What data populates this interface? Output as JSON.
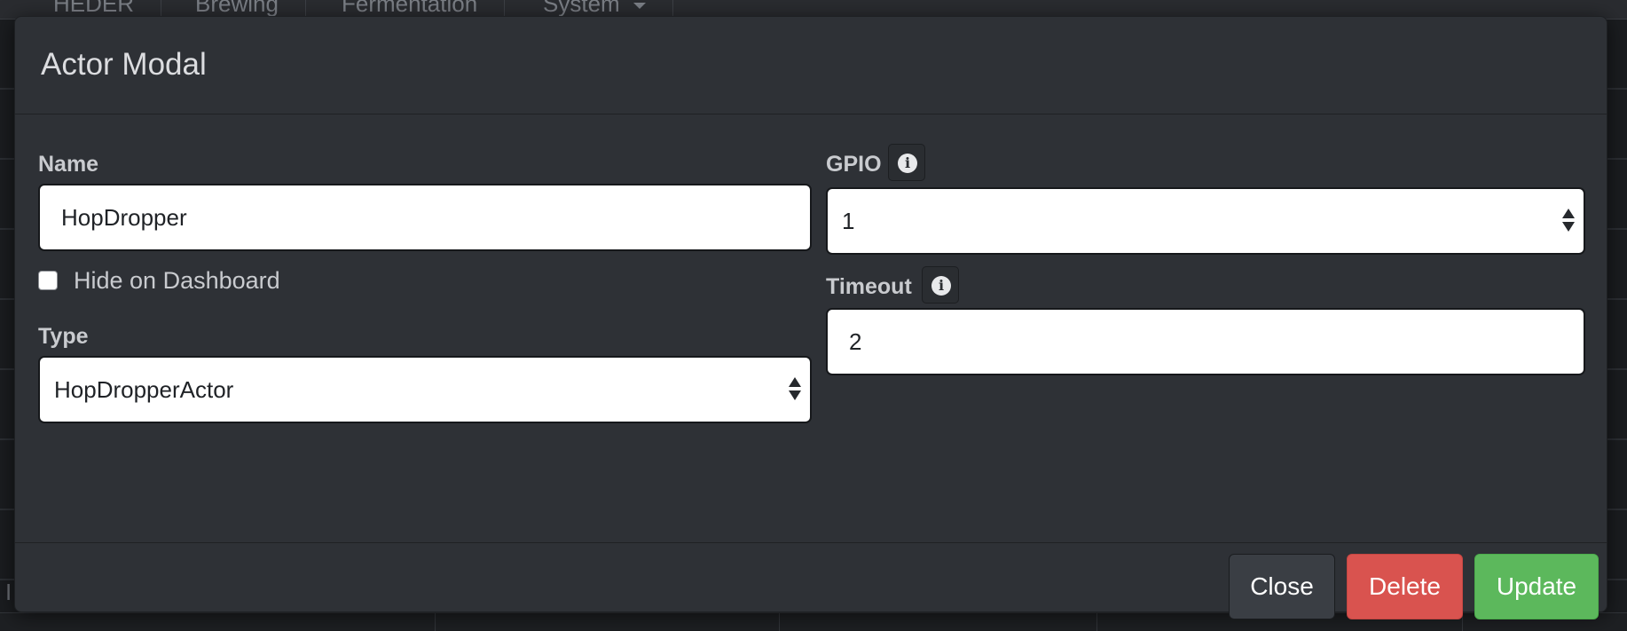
{
  "background": {
    "nav_items": [
      {
        "label": "HEDER"
      },
      {
        "label": "Brewing"
      },
      {
        "label": "Fermentation"
      },
      {
        "label": "System"
      }
    ],
    "edge_letter": "I"
  },
  "modal": {
    "title": "Actor Modal",
    "name": {
      "label": "Name",
      "value": "HopDropper"
    },
    "hide_on_dashboard": {
      "label": "Hide on Dashboard",
      "checked": false
    },
    "type": {
      "label": "Type",
      "selected": "HopDropperActor"
    },
    "gpio": {
      "label": "GPIO",
      "selected": "1"
    },
    "timeout": {
      "label": "Timeout",
      "value": "2"
    },
    "info_icon_glyph": "i",
    "buttons": {
      "close": "Close",
      "delete": "Delete",
      "update": "Update"
    }
  },
  "colors": {
    "delete": "#d9534f",
    "update": "#5cb85c",
    "modal_bg": "#2e3136"
  }
}
